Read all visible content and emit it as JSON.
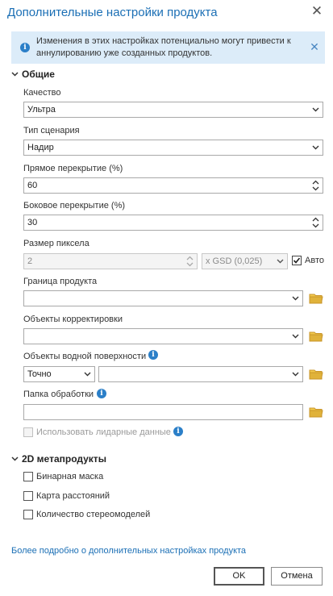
{
  "dialog": {
    "title": "Дополнительные настройки продукта",
    "close_icon": "close-icon"
  },
  "info_bar": {
    "text": "Изменения в этих настройках потенциально могут привести к аннулированию уже созданных продуктов.",
    "icon": "info-icon",
    "dismiss_icon": "close-icon"
  },
  "general": {
    "heading": "Общие",
    "quality": {
      "label": "Качество",
      "value": "Ультра"
    },
    "scenario_type": {
      "label": "Тип сценария",
      "value": "Надир"
    },
    "forward_overlap": {
      "label": "Прямое перекрытие (%)",
      "value": "60"
    },
    "side_overlap": {
      "label": "Боковое перекрытие (%)",
      "value": "30"
    },
    "pixel_size": {
      "label": "Размер пиксела",
      "value": "2",
      "unit": "x GSD (0,025)",
      "auto_label": "Авто",
      "auto_checked": true
    },
    "product_boundary": {
      "label": "Граница продукта",
      "value": ""
    },
    "correction_features": {
      "label": "Объекты корректировки",
      "value": ""
    },
    "water_features": {
      "label": "Объекты водной поверхности",
      "mode": "Точно",
      "value": ""
    },
    "processing_folder": {
      "label": "Папка обработки",
      "value": ""
    },
    "use_lidar": {
      "label": "Использовать лидарные данные",
      "checked": false,
      "enabled": false
    }
  },
  "products_2d": {
    "heading": "2D метапродукты",
    "items": [
      {
        "label": "Бинарная маска",
        "checked": false
      },
      {
        "label": "Карта расстояний",
        "checked": false
      },
      {
        "label": "Количество стереомоделей",
        "checked": false
      }
    ]
  },
  "footer": {
    "help_link": "Более подробно о дополнительных настройках продукта",
    "ok_label": "OK",
    "cancel_label": "Отмена"
  },
  "colors": {
    "accent": "#1b6fb5",
    "info_bg": "#dcecf9",
    "info_icon": "#2b7fc8",
    "folder": "#e0b23a"
  }
}
